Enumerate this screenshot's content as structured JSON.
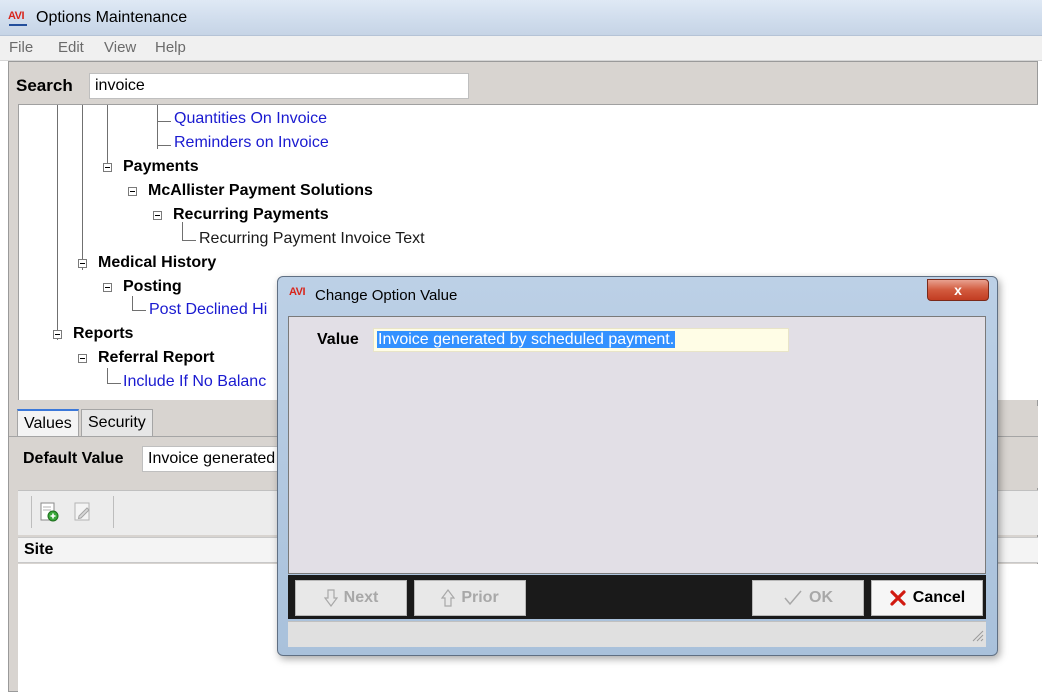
{
  "window": {
    "title": "Options Maintenance",
    "icon": "avi-logo-icon"
  },
  "menu": [
    "File",
    "Edit",
    "View",
    "Help"
  ],
  "search": {
    "label": "Search",
    "value": "invoice"
  },
  "tree": {
    "quantities_on_invoice": "Quantities On Invoice",
    "reminders_on_invoice": "Reminders on Invoice",
    "payments": "Payments",
    "mcallister": "McAllister Payment Solutions",
    "recurring_payments": "Recurring Payments",
    "recurring_payment_invoice_text": "Recurring Payment Invoice Text",
    "medical_history": "Medical History",
    "posting": "Posting",
    "post_declined": "Post Declined Hi",
    "reports": "Reports",
    "referral_report": "Referral Report",
    "include_if_no_balance": "Include If No Balanc"
  },
  "tabs": [
    "Values",
    "Security"
  ],
  "default_value": {
    "label": "Default Value",
    "value": "Invoice generated"
  },
  "grid": {
    "columns": [
      "Site"
    ]
  },
  "dialog": {
    "title": "Change Option Value",
    "close_label": "x",
    "value_label": "Value",
    "value": "Invoice generated by scheduled payment.",
    "buttons": {
      "next": "Next",
      "prior": "Prior",
      "ok": "OK",
      "cancel": "Cancel"
    }
  },
  "colors": {
    "link": "#1a1ad0",
    "selection": "#3391ff",
    "close_button": "#c23d22"
  }
}
